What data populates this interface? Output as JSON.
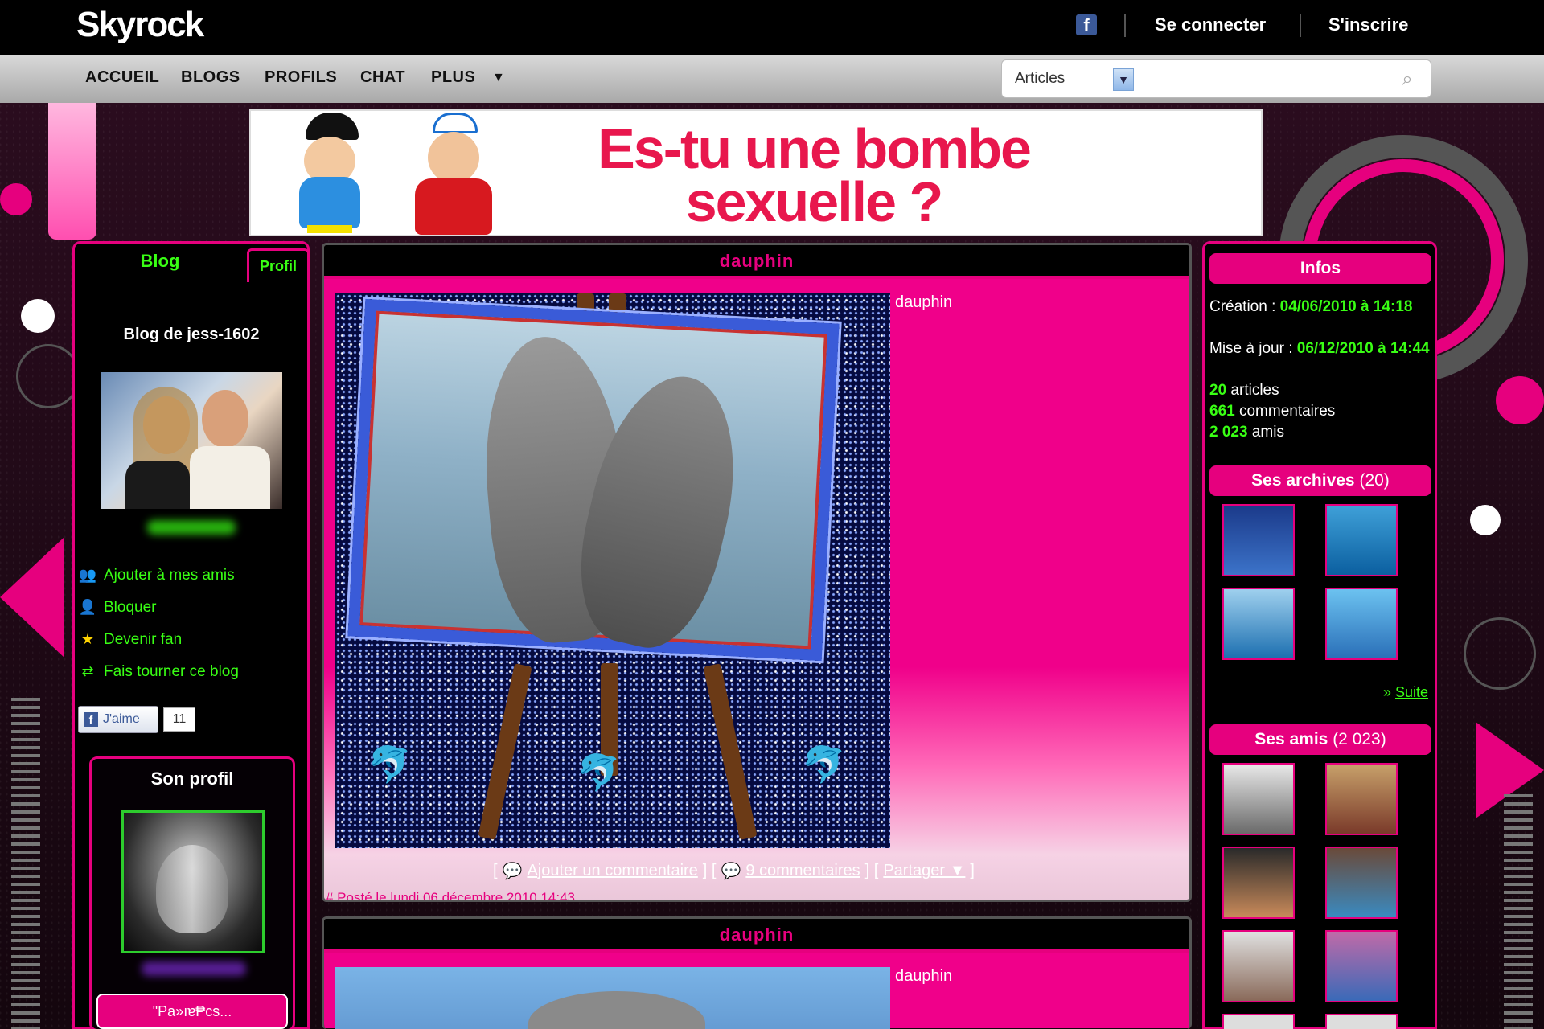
{
  "topbar": {
    "logo": "Skyrock",
    "facebook_icon": "facebook-icon",
    "login": "Se connecter",
    "signup": "S'inscrire"
  },
  "nav": {
    "items": [
      "ACCUEIL",
      "BLOGS",
      "PROFILS",
      "CHAT",
      "PLUS"
    ],
    "more_arrow": "▼"
  },
  "search": {
    "category": "Articles",
    "placeholder": "",
    "icon": "search-icon"
  },
  "banner": {
    "line1": "Es-tu une bombe",
    "line2": "sexuelle ?"
  },
  "left": {
    "tab_blog": "Blog",
    "tab_profil": "Profil",
    "blog_title": "Blog de jess-1602",
    "actions": [
      {
        "label": "Ajouter à mes amis",
        "icon": "add-friend-icon"
      },
      {
        "label": "Bloquer",
        "icon": "block-user-icon"
      },
      {
        "label": "Devenir fan",
        "icon": "star-icon"
      },
      {
        "label": "Fais tourner ce blog",
        "icon": "share-blog-icon"
      }
    ],
    "like_label": "J'aime",
    "like_count": "11",
    "son_profil": "Son profil",
    "mood": "\"Pa»ıɐ₱cs..."
  },
  "articles": [
    {
      "title": "dauphin",
      "caption": "dauphin",
      "add_comment": "Ajouter un commentaire",
      "comments": "9 commentaires",
      "share": "Partager ▼",
      "posted": "# Posté le lundi 06 décembre 2010 14:43"
    },
    {
      "title": "dauphin",
      "caption": "dauphin"
    }
  ],
  "right": {
    "infos_title": "Infos",
    "creation_label": "Création : ",
    "creation_value": "04/06/2010 à 14:18",
    "update_label": "Mise à jour : ",
    "update_value": "06/12/2010 à 14:44",
    "articles_count": "20",
    "articles_label": " articles",
    "comments_count": "661",
    "comments_label": " commentaires",
    "friends_count": "2 023",
    "friends_label": " amis",
    "archives_title": "Ses archives",
    "archives_count": "(20)",
    "suite_prefix": "» ",
    "suite": "Suite",
    "friends_title": "Ses amis",
    "friends_title_count": "(2 023)"
  },
  "colors": {
    "accent_pink": "#e6007e",
    "accent_green": "#39ff14",
    "background": "#1a0a14"
  }
}
